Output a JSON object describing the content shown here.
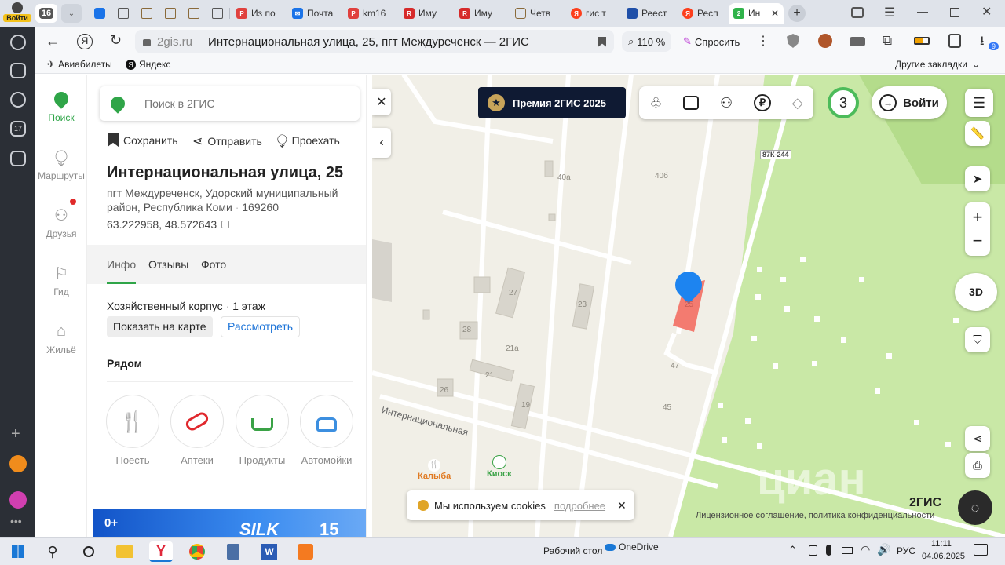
{
  "browser": {
    "profile_label": "Войти",
    "tab_count": "16",
    "tabs": [
      {
        "label": "Из по",
        "fav": "pdf-icon",
        "color": "#e0413e"
      },
      {
        "label": "Почта",
        "fav": "mail-icon",
        "color": "#1a73e8"
      },
      {
        "label": "km16",
        "fav": "pdf-icon",
        "color": "#e0413e"
      },
      {
        "label": "Иму",
        "fav": "rts-icon",
        "color": "#d62a2a"
      },
      {
        "label": "Иму",
        "fav": "rts-icon",
        "color": "#d62a2a"
      },
      {
        "label": "Четв",
        "fav": "doc-icon",
        "color": "#777777"
      },
      {
        "label": "гис т",
        "fav": "yandex-icon",
        "color": "#fc3f1d"
      },
      {
        "label": "Реест",
        "fav": "flag-icon",
        "color": "#1f4fa8"
      },
      {
        "label": "Респ",
        "fav": "yandex-icon",
        "color": "#fc3f1d"
      },
      {
        "label": "Ин",
        "fav": "2gis-icon",
        "color": "#2fb34a"
      }
    ],
    "domain": "2gis.ru",
    "page_title": "Интернациональная улица, 25, пгт Междуреченск — 2ГИС",
    "zoom": "110 %",
    "ask_label": "Спросить",
    "ext_badge": "9",
    "bookmarks": [
      {
        "label": "Авиабилеты",
        "icon": "plane-icon"
      },
      {
        "label": "Яндекс",
        "icon": "yandex-icon"
      }
    ],
    "other_bookmarks": "Другие закладки"
  },
  "nav": {
    "items": [
      {
        "label": "Поиск",
        "icon": "search-leaf-icon",
        "active": true
      },
      {
        "label": "Маршруты",
        "icon": "route-icon"
      },
      {
        "label": "Друзья",
        "icon": "friends-icon"
      },
      {
        "label": "Гид",
        "icon": "flag-icon"
      },
      {
        "label": "Жильё",
        "icon": "house-icon"
      }
    ]
  },
  "panel": {
    "search_placeholder": "Поиск в 2ГИС",
    "actions": {
      "save": "Сохранить",
      "send": "Отправить",
      "go": "Проехать"
    },
    "title": "Интернациональная улица, 25",
    "address_line1": "пгт Междуреченск, Удорский муниципальный",
    "address_line2": "район, Республика Коми",
    "postcode": "169260",
    "coords": "63.222958, 48.572643",
    "tabs": [
      "Инфо",
      "Отзывы",
      "Фото"
    ],
    "building_type": "Хозяйственный корпус",
    "floors": "1 этаж",
    "show_on_map": "Показать на карте",
    "consider": "Рассмотреть",
    "nearby_title": "Рядом",
    "nearby": [
      {
        "label": "Поесть",
        "icon": "fork-knife-icon"
      },
      {
        "label": "Аптеки",
        "icon": "pills-icon"
      },
      {
        "label": "Продукты",
        "icon": "basket-icon"
      },
      {
        "label": "Автомойки",
        "icon": "car-wash-icon"
      }
    ],
    "ad": {
      "age": "0+",
      "brand": "SILK",
      "num": "15"
    }
  },
  "map": {
    "premium_label": "Премия 2ГИС 2025",
    "notif_count": "3",
    "login_label": "Войти",
    "road_badge": "87К-244",
    "street": "Интернациональная",
    "three_d": "3D",
    "cookies_text": "Мы используем cookies",
    "cookies_link": "подробнее",
    "logo": "2ГИС",
    "footer": "Лицензионное соглашение, политика конфиденциальности",
    "watermark": "циан",
    "pois": [
      {
        "label": "Калыба",
        "color": "#e07a22"
      },
      {
        "label": "Киоск",
        "color": "#3aa246"
      }
    ],
    "house_numbers": [
      "40а",
      "40б",
      "27",
      "23",
      "28",
      "21а",
      "21",
      "26",
      "19",
      "47",
      "45",
      "25"
    ]
  },
  "taskbar": {
    "desktop_label": "Рабочий стол",
    "onedrive": "OneDrive",
    "lang": "РУС",
    "time": "11:11",
    "date": "04.06.2025"
  }
}
